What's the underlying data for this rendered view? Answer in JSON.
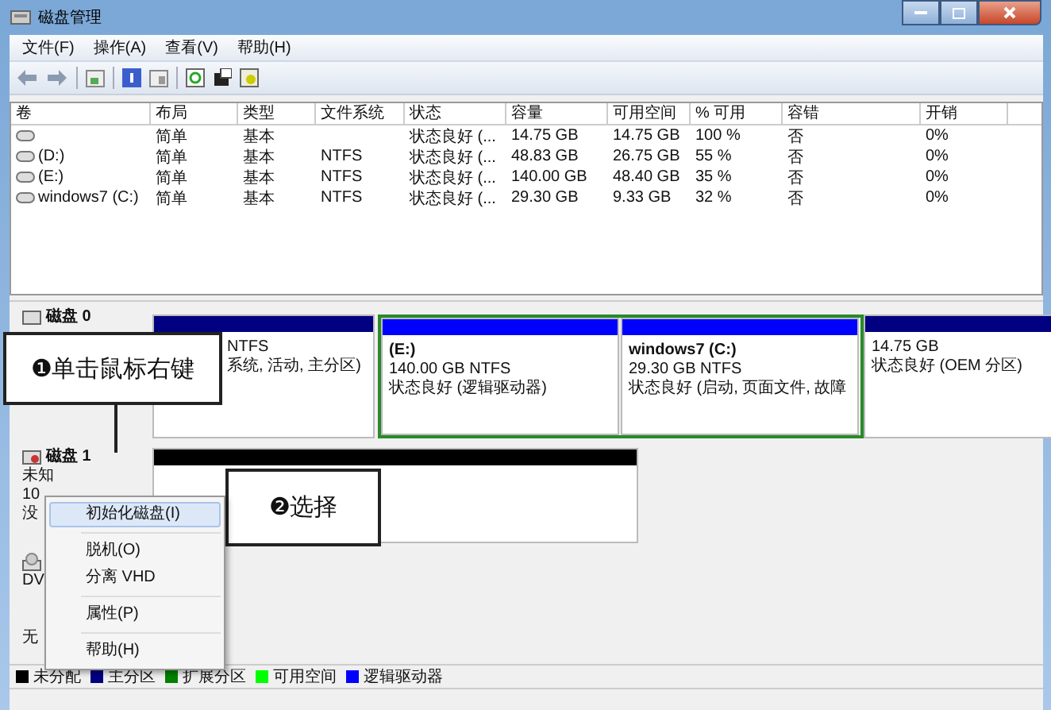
{
  "window": {
    "title": "磁盘管理"
  },
  "menu": [
    "文件(F)",
    "操作(A)",
    "查看(V)",
    "帮助(H)"
  ],
  "table": {
    "columns": [
      "卷",
      "布局",
      "类型",
      "文件系统",
      "状态",
      "容量",
      "可用空间",
      "% 可用",
      "容错",
      "开销"
    ],
    "rows": [
      [
        "",
        "简单",
        "基本",
        "",
        "状态良好 (...",
        "14.75 GB",
        "14.75 GB",
        "100 %",
        "否",
        "0%"
      ],
      [
        "(D:)",
        "简单",
        "基本",
        "NTFS",
        "状态良好 (...",
        "48.83 GB",
        "26.75 GB",
        "55 %",
        "否",
        "0%"
      ],
      [
        "(E:)",
        "简单",
        "基本",
        "NTFS",
        "状态良好 (...",
        "140.00 GB",
        "48.40 GB",
        "35 %",
        "否",
        "0%"
      ],
      [
        "windows7 (C:)",
        "简单",
        "基本",
        "NTFS",
        "状态良好 (...",
        "29.30 GB",
        "9.33 GB",
        "32 %",
        "否",
        "0%"
      ]
    ]
  },
  "disks": [
    {
      "label": "磁盘 0",
      "partitions": [
        {
          "kind": "primary",
          "lines": [
            "NTFS",
            "系统, 活动, 主分区)"
          ]
        },
        {
          "kind": "extended",
          "children": [
            {
              "kind": "logical",
              "title": "(E:)",
              "lines": [
                "140.00 GB NTFS",
                "状态良好 (逻辑驱动器)"
              ]
            },
            {
              "kind": "logical",
              "title": "windows7  (C:)",
              "lines": [
                "29.30 GB NTFS",
                "状态良好 (启动, 页面文件, 故障"
              ]
            }
          ]
        },
        {
          "kind": "primary",
          "lines": [
            "14.75 GB",
            "状态良好 (OEM 分区)"
          ]
        }
      ]
    },
    {
      "label": "磁盘 1",
      "lines": [
        "未知",
        "10",
        "没"
      ],
      "partitions": [
        {
          "kind": "unallocated"
        }
      ]
    },
    {
      "lines": [
        "DV",
        "无"
      ]
    }
  ],
  "context_menu": [
    {
      "kind": "item",
      "label": "初始化磁盘(I)",
      "selected": true
    },
    {
      "kind": "separator"
    },
    {
      "kind": "item",
      "label": "脱机(O)",
      "selected": false
    },
    {
      "kind": "item",
      "label": "分离 VHD",
      "selected": false
    },
    {
      "kind": "separator"
    },
    {
      "kind": "item",
      "label": "属性(P)",
      "selected": false
    },
    {
      "kind": "separator"
    },
    {
      "kind": "item",
      "label": "帮助(H)",
      "selected": false
    }
  ],
  "callouts": [
    "❶单击鼠标右键",
    "❷选择"
  ],
  "legend": [
    {
      "label": "未分配",
      "color": "#000000"
    },
    {
      "label": "主分区",
      "color": "#000080"
    },
    {
      "label": "扩展分区",
      "color": "#008000"
    },
    {
      "label": "可用空间",
      "color": "#00ff00"
    },
    {
      "label": "逻辑驱动器",
      "color": "#0000ff"
    }
  ]
}
